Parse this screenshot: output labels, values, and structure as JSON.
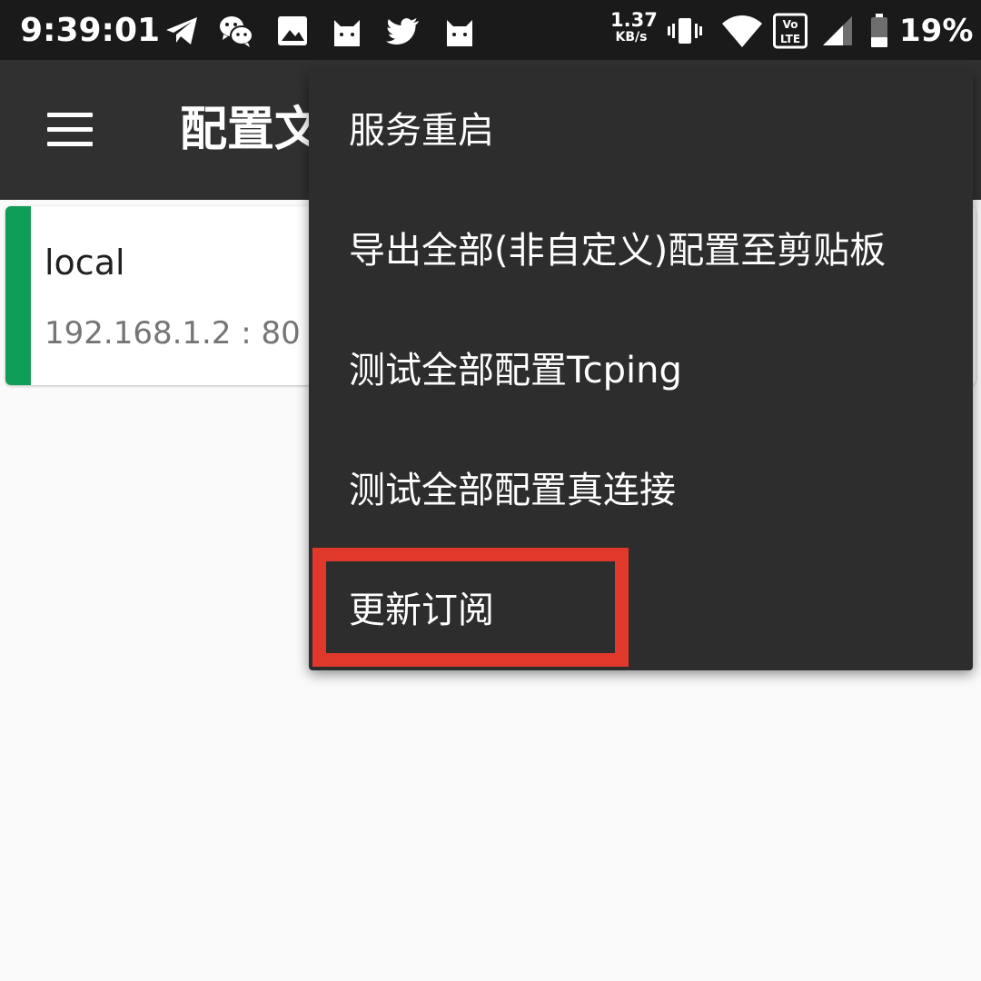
{
  "status_bar": {
    "time": "9:39:01",
    "net_speed_value": "1.37",
    "net_speed_unit": "KB/s",
    "volte_label_top": "Vo",
    "volte_label_bottom": "LTE",
    "battery_percent": "19%",
    "left_icons": [
      "telegram-icon",
      "wechat-icon",
      "gallery-icon",
      "cat-icon",
      "twitter-icon",
      "cat-icon"
    ],
    "right_icons": [
      "vibrate-icon",
      "wifi-icon",
      "volte-icon",
      "signal-icon",
      "battery-icon"
    ]
  },
  "app_bar": {
    "title": "配置文件",
    "menu_icon": "hamburger-menu-icon",
    "background": "#303030"
  },
  "server_list": [
    {
      "name": "local",
      "address": "192.168.1.2 : 80",
      "accent_color": "#0f9d58"
    }
  ],
  "overflow_menu": {
    "items": [
      {
        "label": "服务重启"
      },
      {
        "label": "导出全部(非自定义)配置至剪贴板"
      },
      {
        "label": "测试全部配置Tcping"
      },
      {
        "label": "测试全部配置真连接"
      },
      {
        "label": "更新订阅",
        "highlighted": true
      }
    ],
    "background": "#2d2d2d"
  },
  "highlight_color": "#e0382b"
}
